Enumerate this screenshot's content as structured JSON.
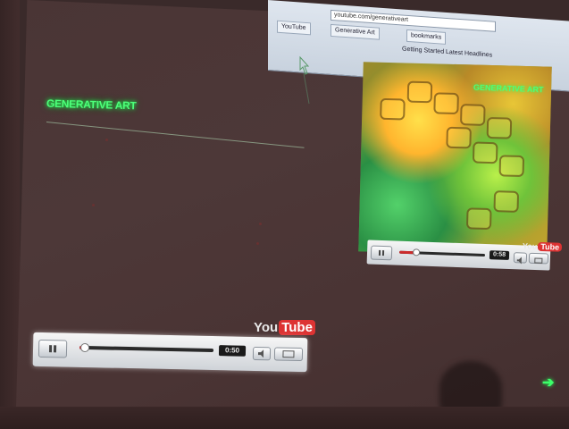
{
  "browser": {
    "url": "youtube.com/generativeart",
    "tabs": [
      "YouTube",
      "Generative Art",
      "bookmarks"
    ],
    "bookmarks": "Getting Started   Latest Headlines"
  },
  "left_video": {
    "title": "GENERATIVE ART",
    "logo_you": "You",
    "logo_tube": "Tube",
    "time": "0:50",
    "progress": 0.03,
    "play_icon": "pause-icon",
    "volume_icon": "volume-icon",
    "fullscreen_icon": "fullscreen-icon"
  },
  "right_video": {
    "title": "GENERATIVE ART",
    "logo_you": "You",
    "logo_tube": "Tube",
    "time": "0:58",
    "progress": 0.2,
    "play_icon": "pause-icon",
    "volume_icon": "volume-icon",
    "fullscreen_icon": "fullscreen-icon"
  },
  "nav": {
    "next_arrow": "➔",
    "next_icon": "arrow-right-icon"
  },
  "colors": {
    "accent_green": "#4dff7a",
    "progress_red": "#cc2b2b",
    "screen_bg": "#4a3535"
  }
}
